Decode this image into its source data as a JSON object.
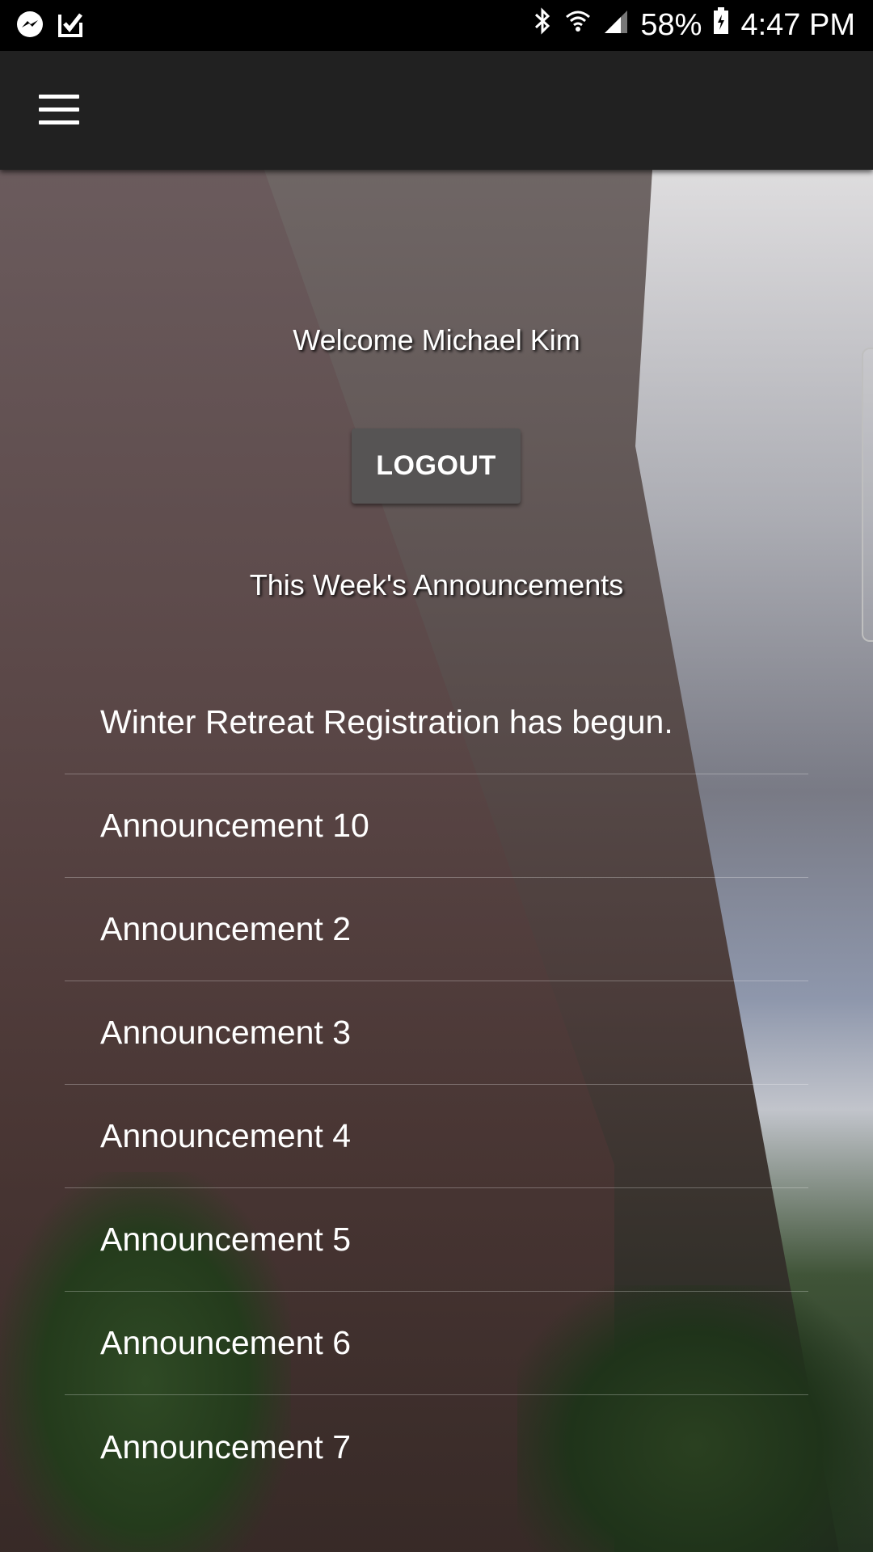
{
  "status_bar": {
    "left_icons": [
      "messenger-icon",
      "task-check-icon"
    ],
    "right_icons": [
      "bluetooth-icon",
      "wifi-icon",
      "cell-signal-icon",
      "battery-icon"
    ],
    "battery_percent": "58%",
    "time": "4:47 PM"
  },
  "app_bar": {
    "menu_icon": "hamburger-menu-icon"
  },
  "main": {
    "welcome_text": "Welcome Michael Kim",
    "logout_label": "LOGOUT",
    "announcements_heading": "This Week's Announcements",
    "announcements": [
      "Winter Retreat Registration has begun.",
      "Announcement 10",
      "Announcement 2",
      "Announcement 3",
      "Announcement 4",
      "Announcement 5",
      "Announcement 6",
      "Announcement 7"
    ]
  },
  "colors": {
    "status_bar": "#000000",
    "app_bar": "#212121",
    "button": "#565454",
    "text": "#ffffff"
  }
}
